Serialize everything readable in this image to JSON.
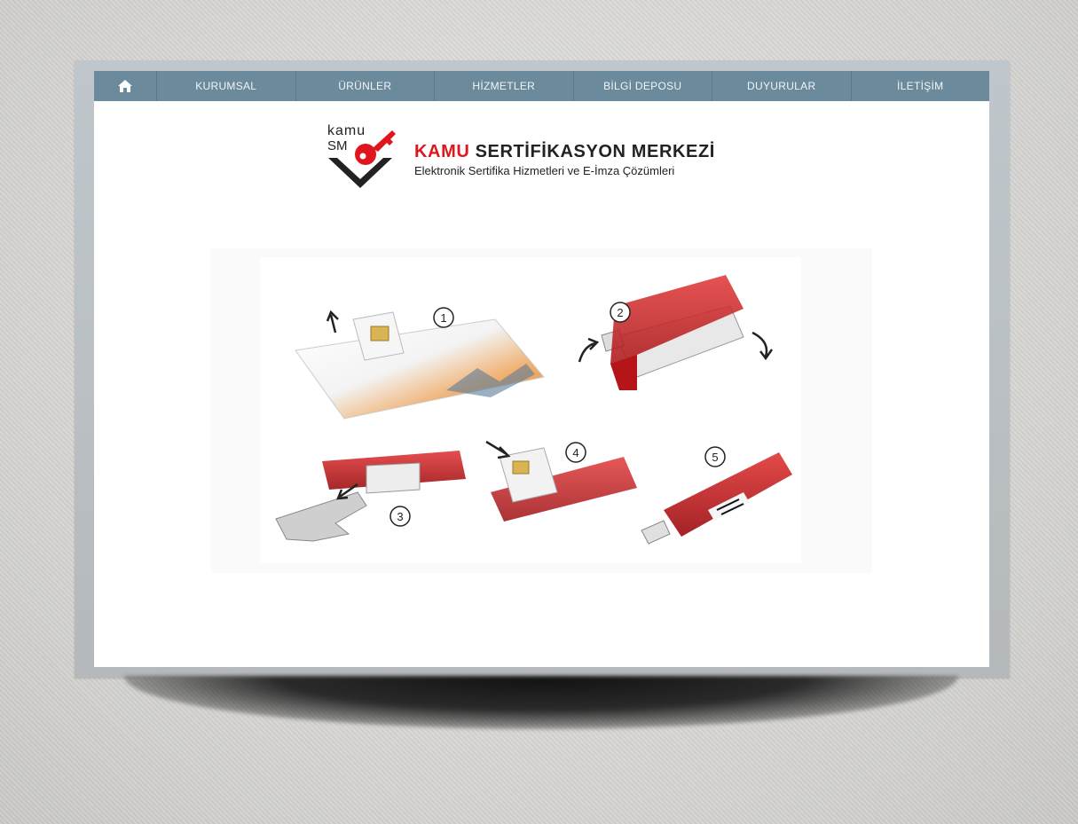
{
  "nav": {
    "home_icon": "home-icon",
    "items": [
      {
        "label": "KURUMSAL"
      },
      {
        "label": "ÜRÜNLER"
      },
      {
        "label": "HİZMETLER"
      },
      {
        "label": "BİLGİ DEPOSU"
      },
      {
        "label": "DUYURULAR"
      },
      {
        "label": "İLETİŞİM"
      }
    ]
  },
  "logo": {
    "small_top": "kamu",
    "small_bottom": "SM",
    "title_highlight": "KAMU",
    "title_rest": "SERTİFİKASYON MERKEZİ",
    "subtitle": "Elektronik Sertifika Hizmetleri ve E-İmza Çözümleri"
  },
  "illustration": {
    "steps": [
      "①",
      "②",
      "③",
      "④",
      "⑤"
    ]
  },
  "colors": {
    "nav_bg": "#6b8a9b",
    "brand_red": "#e0161e",
    "token_red": "#c8161c"
  }
}
